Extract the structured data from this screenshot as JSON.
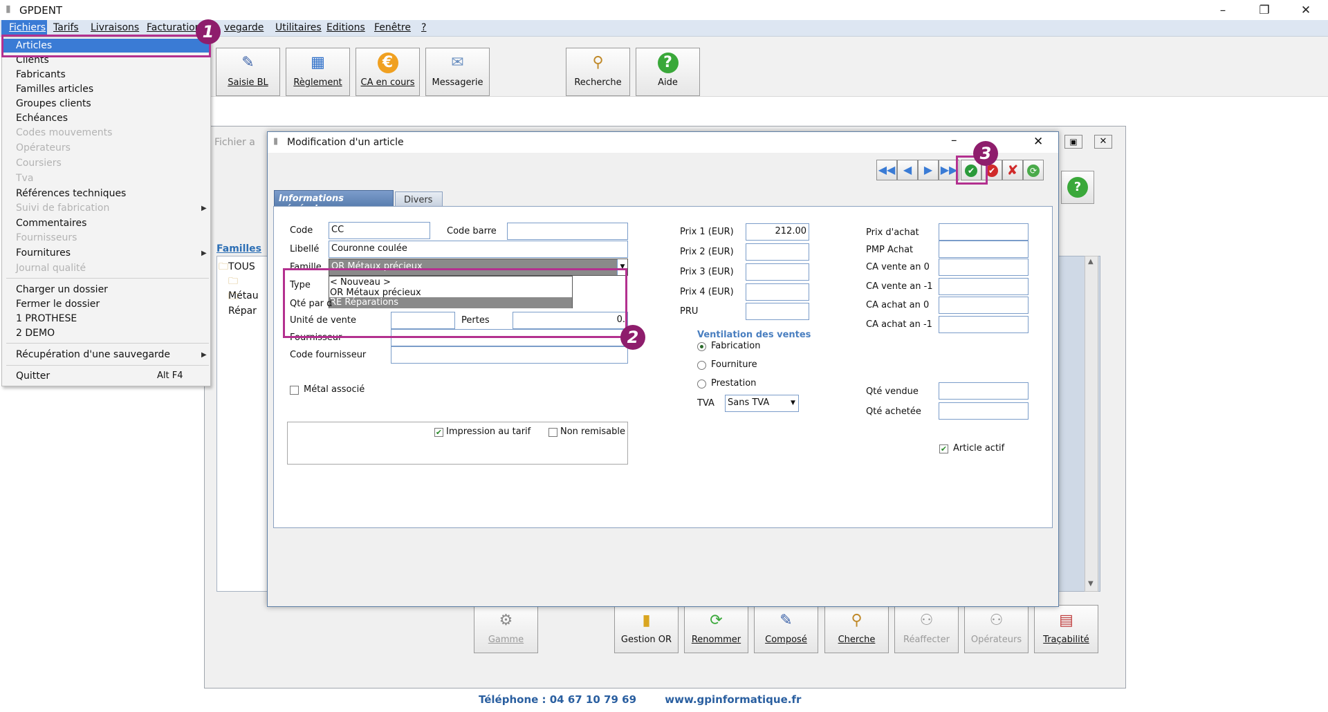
{
  "app": {
    "title": "GPDENT",
    "window_controls": [
      "–",
      "❐",
      "✕"
    ]
  },
  "menubar": {
    "items": [
      "Fichiers",
      "Tarifs",
      "Livraisons",
      "Facturation",
      "vegarde",
      "Utilitaires",
      "Editions",
      "Fenêtre",
      "?"
    ]
  },
  "file_menu": {
    "items": [
      {
        "label": "Articles",
        "disabled": false,
        "selected": true
      },
      {
        "label": "Clients",
        "disabled": false
      },
      {
        "label": "Fabricants",
        "disabled": false
      },
      {
        "label": "Familles articles",
        "disabled": false
      },
      {
        "label": "Groupes clients",
        "disabled": false
      },
      {
        "label": "Echéances",
        "disabled": false
      },
      {
        "label": "Codes mouvements",
        "disabled": true
      },
      {
        "label": "Opérateurs",
        "disabled": true
      },
      {
        "label": "Coursiers",
        "disabled": true
      },
      {
        "label": "Tva",
        "disabled": true
      },
      {
        "label": "Références techniques",
        "disabled": false
      },
      {
        "label": "Suivi de fabrication",
        "disabled": true,
        "submenu": true
      },
      {
        "label": "Commentaires",
        "disabled": false
      },
      {
        "label": "Fournisseurs",
        "disabled": true
      },
      {
        "label": "Fournitures",
        "disabled": false,
        "submenu": true
      },
      {
        "label": "Journal qualité",
        "disabled": true
      },
      {
        "label": "Charger un dossier",
        "disabled": false
      },
      {
        "label": "Fermer le dossier",
        "disabled": false
      },
      {
        "label": "1 PROTHESE",
        "disabled": false
      },
      {
        "label": "2 DEMO",
        "disabled": false
      },
      {
        "label": "Récupération d'une sauvegarde",
        "disabled": false,
        "submenu": true
      },
      {
        "label": "Quitter",
        "disabled": false,
        "shortcut": "Alt F4"
      }
    ]
  },
  "toolbar": {
    "buttons": [
      {
        "label": "Saisie BL",
        "icon": "pen-paper-icon"
      },
      {
        "label": "Règlement",
        "icon": "credit-card-icon"
      },
      {
        "label": "CA en cours",
        "icon": "euro-icon"
      },
      {
        "label": "Messagerie",
        "icon": "envelope-icon"
      },
      {
        "label": "Recherche",
        "icon": "magnifier-icon"
      },
      {
        "label": "Aide",
        "icon": "help-icon"
      }
    ]
  },
  "bg_window": {
    "title": "Fichier a",
    "familles_label": "Familles",
    "tree": [
      "TOUS",
      "Métau",
      "Répar"
    ],
    "bottom_buttons": [
      {
        "label": "Gamme",
        "disabled": true
      },
      {
        "label": "Gestion OR",
        "disabled": false
      },
      {
        "label": "Renommer",
        "disabled": false
      },
      {
        "label": "Composé",
        "disabled": false
      },
      {
        "label": "Cherche",
        "disabled": false
      },
      {
        "label": "Réaffecter",
        "disabled": true
      },
      {
        "label": "Opérateurs",
        "disabled": true
      },
      {
        "label": "Traçabilité",
        "disabled": false
      }
    ]
  },
  "dialog": {
    "title": "Modification d'un article",
    "tabs": [
      "Informations générales",
      "Divers"
    ],
    "fields": {
      "code_label": "Code",
      "code_value": "CC",
      "code_barre_label": "Code barre",
      "code_barre_value": "",
      "libelle_label": "Libellé",
      "libelle_value": "Couronne coulée",
      "famille_label": "Famille",
      "famille_value": "OR Métaux précieux",
      "type_label": "Type",
      "qte_label": "Qté par d",
      "unite_label": "Unité de vente",
      "pertes_label": "Pertes",
      "pertes_value": "0.",
      "fournisseur_label": "Fournisseur",
      "code_fournisseur_label": "Code fournisseur",
      "metal_label": "Métal associé",
      "impression_label": "Impression au tarif",
      "non_remisable_label": "Non remisable"
    },
    "famille_options": [
      "< Nouveau >",
      "OR Métaux précieux",
      "RE Réparations"
    ],
    "prices": [
      {
        "label": "Prix 1  (EUR)",
        "value": "212.00"
      },
      {
        "label": "Prix 2  (EUR)",
        "value": ""
      },
      {
        "label": "Prix 3  (EUR)",
        "value": ""
      },
      {
        "label": "Prix 4  (EUR)",
        "value": ""
      },
      {
        "label": "PRU",
        "value": ""
      }
    ],
    "ventilation": {
      "title": "Ventilation des ventes",
      "options": [
        "Fabrication",
        "Fourniture",
        "Prestation"
      ],
      "selected": "Fabrication"
    },
    "tva_label": "TVA",
    "tva_value": "Sans TVA",
    "right_labels": [
      "Prix d'achat",
      "PMP Achat",
      "CA vente an 0",
      "CA vente an -1",
      "CA achat an 0",
      "CA achat an -1"
    ],
    "qte_vendue_label": "Qté vendue",
    "qte_achetee_label": "Qté achetée",
    "article_actif_label": "Article actif"
  },
  "badges": [
    "1",
    "2",
    "3"
  ],
  "footer": {
    "phone": "Téléphone : 04 67 10 79 69",
    "website": "www.gpinformatique.fr"
  },
  "colors": {
    "accent": "#b3308f",
    "menu_selected": "#3a7bd5",
    "tab_active": "#5a7fb0"
  }
}
